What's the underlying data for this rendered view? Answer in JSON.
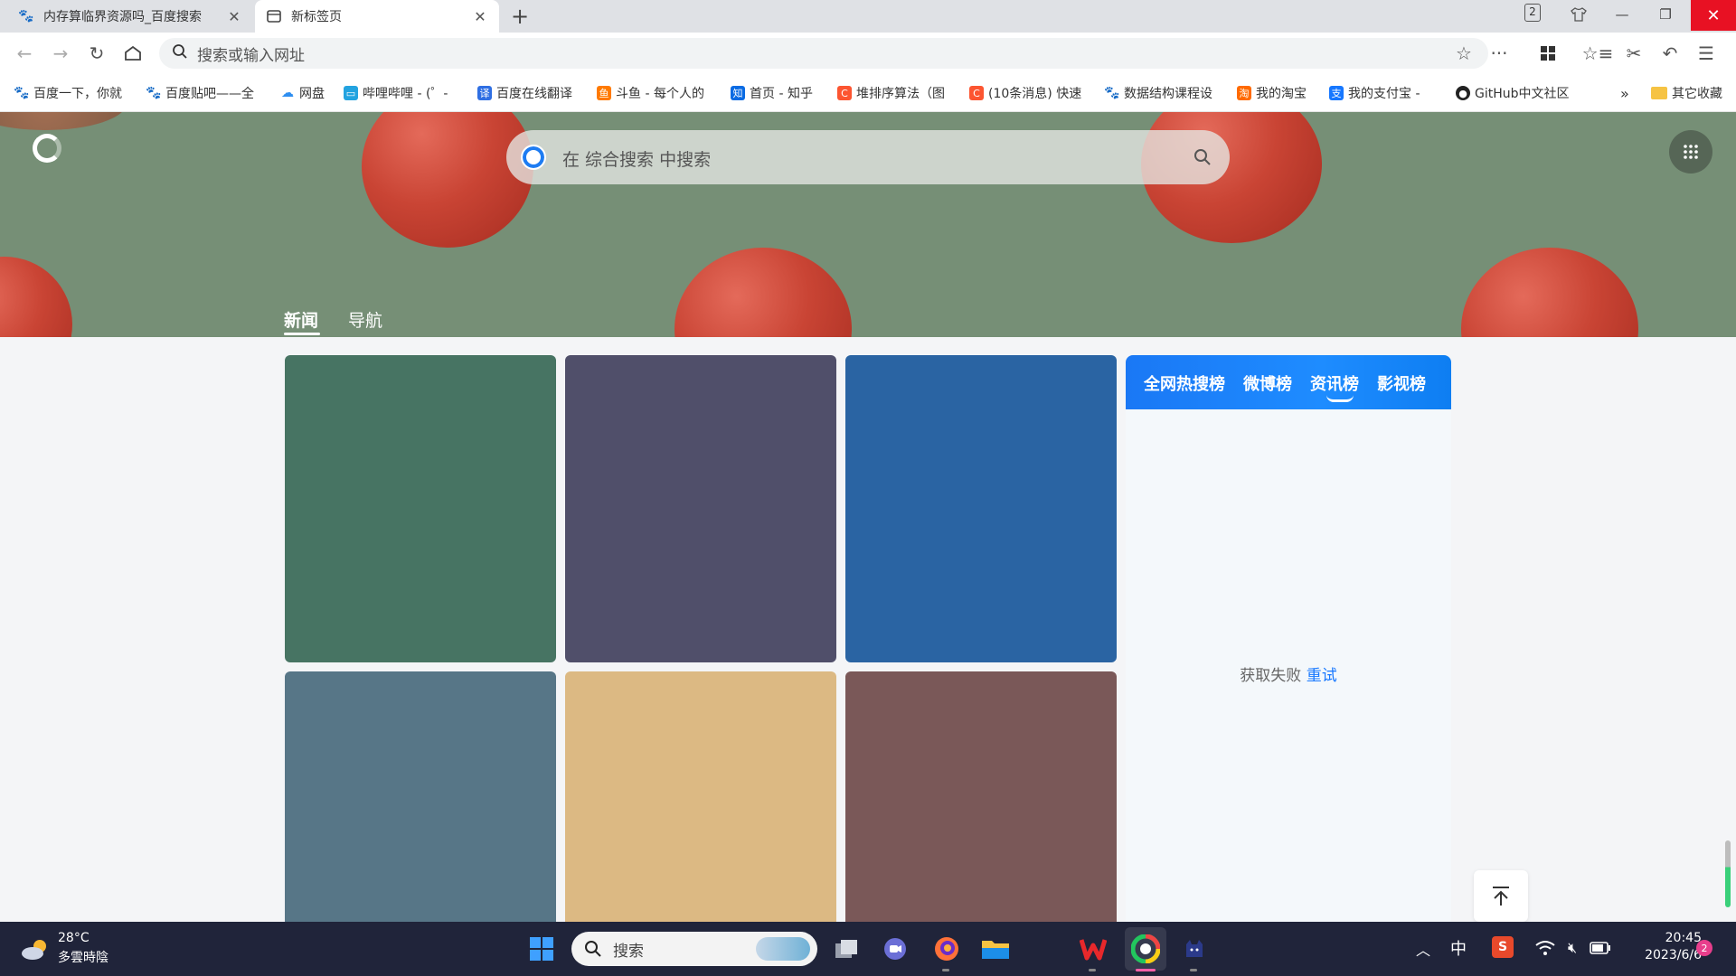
{
  "tabs": [
    {
      "label": "内存算临界资源吗_百度搜索",
      "icon": "baidu-paw-icon"
    },
    {
      "label": "新标签页",
      "icon": "newtab-icon"
    }
  ],
  "tab_counter": "2",
  "address": {
    "placeholder": "搜索或输入网址"
  },
  "bookmarks": [
    {
      "label": "百度一下，你就",
      "icon": "baidu-paw-icon",
      "color": "#2a4bd8"
    },
    {
      "label": "百度贴吧——全",
      "icon": "baidu-paw-icon",
      "color": "#2a4bd8"
    },
    {
      "label": "网盘",
      "icon": "cloud-icon",
      "color": "#2e8ef0"
    },
    {
      "label": "哔哩哔哩 - (゜-",
      "icon": "bilibili-icon",
      "color": "#23a3e0"
    },
    {
      "label": "百度在线翻译",
      "icon": "translate-icon",
      "color": "#2f6fe3"
    },
    {
      "label": "斗鱼 - 每个人的",
      "icon": "douyu-icon",
      "color": "#ff7a00"
    },
    {
      "label": "首页 - 知乎",
      "icon": "zhihu-icon",
      "color": "#0a6be3"
    },
    {
      "label": "堆排序算法（图",
      "icon": "csdn-icon",
      "color": "#fc5531"
    },
    {
      "label": "(10条消息) 快速",
      "icon": "csdn-icon",
      "color": "#fc5531"
    },
    {
      "label": "数据结构课程设",
      "icon": "baidu-paw-icon",
      "color": "#2a4bd8"
    },
    {
      "label": "我的淘宝",
      "icon": "taobao-icon",
      "color": "#ff6a00"
    },
    {
      "label": "我的支付宝 -",
      "icon": "alipay-icon",
      "color": "#1677ff"
    },
    {
      "label": "GitHub中文社区",
      "icon": "github-icon",
      "color": "#222222"
    }
  ],
  "bookmarks_overflow": "»",
  "other_bookmarks": "其它收藏",
  "hero": {
    "search_placeholder": "在 综合搜索 中搜索",
    "tabs": [
      "新闻",
      "导航"
    ]
  },
  "cards": [
    {
      "color": "#477463"
    },
    {
      "color": "#504f6a"
    },
    {
      "color": "#2a64a3"
    },
    {
      "color": "#577687"
    },
    {
      "color": "#dcb983"
    },
    {
      "color": "#7a5858"
    }
  ],
  "hot_panel": {
    "tabs": [
      "全网热搜榜",
      "微博榜",
      "资讯榜",
      "影视榜"
    ],
    "active_tab": "资讯榜",
    "error_text": "获取失败",
    "retry_label": "重试"
  },
  "taskbar": {
    "weather_temp": "28°C",
    "weather_desc": "多雲時陰",
    "search_placeholder": "搜索",
    "ime": "中",
    "time": "20:45",
    "date": "2023/6/6",
    "notification_count": "2"
  }
}
